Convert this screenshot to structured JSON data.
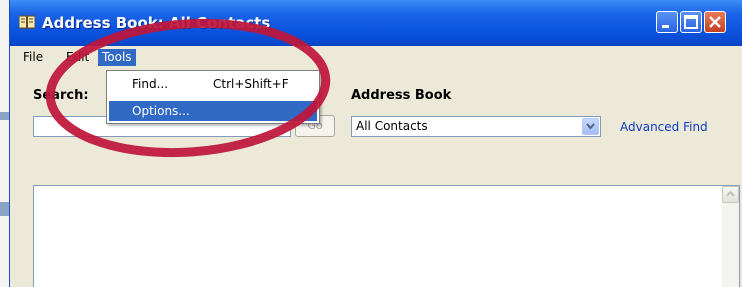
{
  "window": {
    "title": "Address Book: All Contacts",
    "title_icon": "address-book-icon",
    "controls": [
      "minimize-icon",
      "maximize-icon",
      "close-icon"
    ]
  },
  "menubar": {
    "items": [
      {
        "label": "File"
      },
      {
        "label": "Edit"
      },
      {
        "label": "Tools"
      }
    ],
    "active": "Tools"
  },
  "tools_menu": {
    "items": [
      {
        "label": "Find...",
        "shortcut": "Ctrl+Shift+F"
      },
      {
        "label": "Options..."
      }
    ],
    "highlighted": "Options..."
  },
  "search": {
    "label": "Search:",
    "value": "",
    "go_label": "Go"
  },
  "address_book": {
    "label": "Address Book",
    "selected": "All Contacts"
  },
  "advanced_find_label": "Advanced Find",
  "colors": {
    "titlebar": "#0a52de",
    "menu_highlight": "#316ac5",
    "window_bg": "#ece9d8",
    "link": "#0b3cc5",
    "annotation_circle": "#c0163a"
  }
}
